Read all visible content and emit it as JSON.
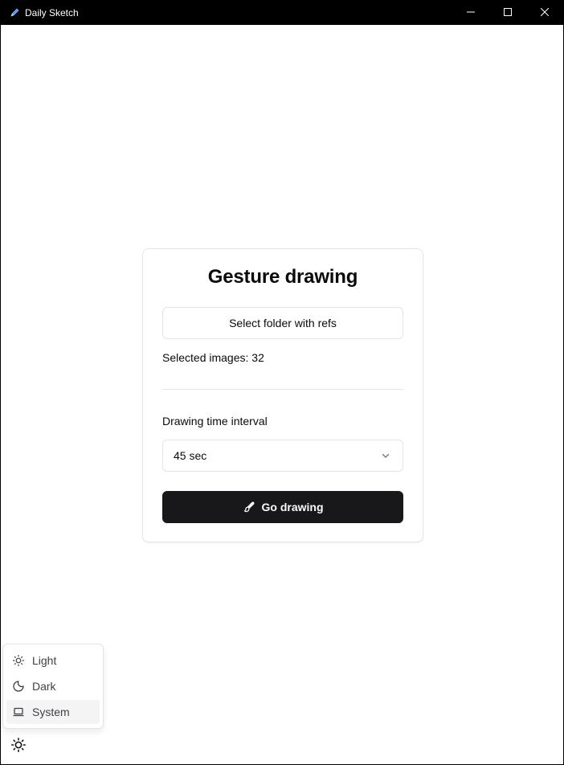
{
  "window": {
    "title": "Daily Sketch",
    "app_icon": "pencil-icon",
    "controls": [
      "minimize-icon",
      "maximize-icon",
      "close-icon"
    ]
  },
  "card": {
    "title": "Gesture drawing",
    "select_folder_label": "Select folder with refs",
    "selected_images_label": "Selected images:",
    "selected_images_count": "32",
    "interval_label": "Drawing time interval",
    "interval_value": "45 sec",
    "go_label": "Go drawing",
    "go_icon": "paintbrush-icon"
  },
  "theme_menu": {
    "items": [
      {
        "label": "Light",
        "icon": "sun-icon"
      },
      {
        "label": "Dark",
        "icon": "moon-icon"
      },
      {
        "label": "System",
        "icon": "laptop-icon",
        "active": true
      }
    ],
    "toggle_icon": "sun-icon"
  },
  "colors": {
    "primary_button": "#18181b",
    "border": "#e4e4e7",
    "menu_active_bg": "#f4f4f5",
    "titlebar": "#000000"
  }
}
